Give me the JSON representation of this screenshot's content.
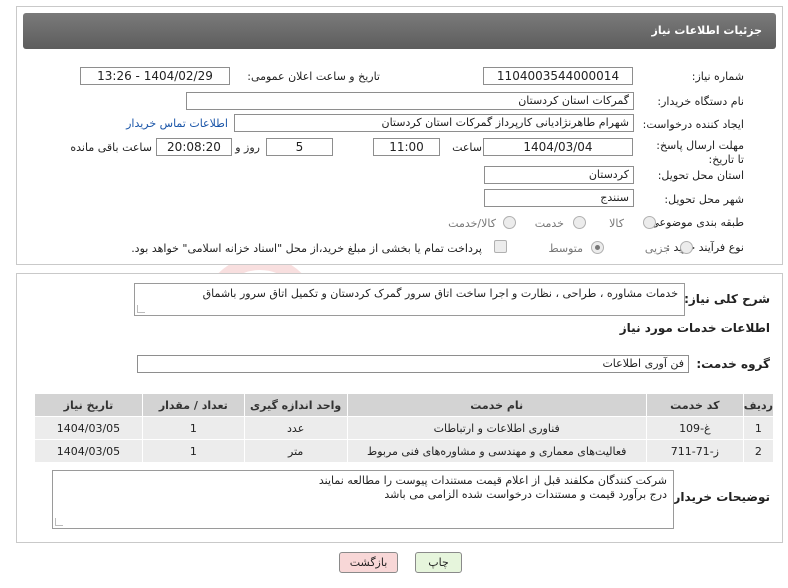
{
  "header": {
    "title": "جزئیات اطلاعات نیاز"
  },
  "labels": {
    "need_number": "شماره نیاز:",
    "announce_datetime": "تاریخ و ساعت اعلان عمومی:",
    "buyer_org": "نام دستگاه خریدار:",
    "requester": "ایجاد کننده درخواست:",
    "deadline": "مهلت ارسال پاسخ: تا تاریخ:",
    "time_word": "ساعت",
    "day_word": "روز و",
    "remaining_word": "ساعت باقی مانده",
    "province": "استان محل تحویل:",
    "city": "شهر محل تحویل:",
    "category": "طبقه بندی موضوعی:",
    "process_type": "نوع فرآیند خرید :",
    "description": "شرح کلی نیاز:",
    "services_info": "اطلاعات خدمات مورد نیاز",
    "service_group": "گروه خدمت:",
    "buyer_notes": "توضیحات خریدار:"
  },
  "values": {
    "need_number": "1104003544000014",
    "announce_datetime": "1404/02/29 - 13:26",
    "buyer_org": "گمرکات استان کردستان",
    "requester": "شهرام  طاهرنژادیانی کارپرداز گمرکات استان کردستان",
    "contact_link": "اطلاعات تماس خریدار",
    "deadline_date": "1404/03/04",
    "deadline_time": "11:00",
    "remaining_days": "5",
    "remaining_time": "20:08:20",
    "province": "کردستان",
    "city": "سنندج",
    "description": "خدمات مشاوره ، طراحی ، نظارت و اجرا  ساخت اتاق سرور گمرک کردستان و تکمیل اتاق سرور باشماق",
    "service_group": "فن آوری اطلاعات",
    "buyer_notes_line1": "شرکت کنندگان مکلفند قبل از اعلام قیمت مستندات پیوست را مطالعه نمایند",
    "buyer_notes_line2": "درج برآورد قیمت و مستندات درخواست شده الزامی می باشد"
  },
  "category_options": [
    {
      "label": "کالا",
      "checked": false
    },
    {
      "label": "خدمت",
      "checked": false
    },
    {
      "label": "کالا/خدمت",
      "checked": false
    }
  ],
  "process_options": [
    {
      "label": "جزیی",
      "checked": false
    },
    {
      "label": "متوسط",
      "checked": true
    }
  ],
  "payment_note": "پرداخت تمام یا بخشی از مبلغ خرید،از محل \"اسناد خزانه اسلامی\" خواهد بود.",
  "table": {
    "headers": [
      "ردیف",
      "کد خدمت",
      "نام خدمت",
      "واحد اندازه گیری",
      "تعداد / مقدار",
      "تاریخ نیاز"
    ],
    "rows": [
      [
        "1",
        "غ-109",
        "فناوری اطلاعات و ارتباطات",
        "عدد",
        "1",
        "1404/03/05"
      ],
      [
        "2",
        "ز-71-711",
        "فعالیت‌های معماری و مهندسی و مشاوره‌های فنی مربوط",
        "متر",
        "1",
        "1404/03/05"
      ]
    ]
  },
  "buttons": {
    "print": "چاپ",
    "back": "بازگشت"
  },
  "watermark": {
    "text": "AriaTender.neT"
  },
  "colors": {
    "title_bar": "#6b6b6b",
    "link": "#1a55a8",
    "back_button": "#f8d7d7",
    "print_button": "#e6f5dc"
  }
}
